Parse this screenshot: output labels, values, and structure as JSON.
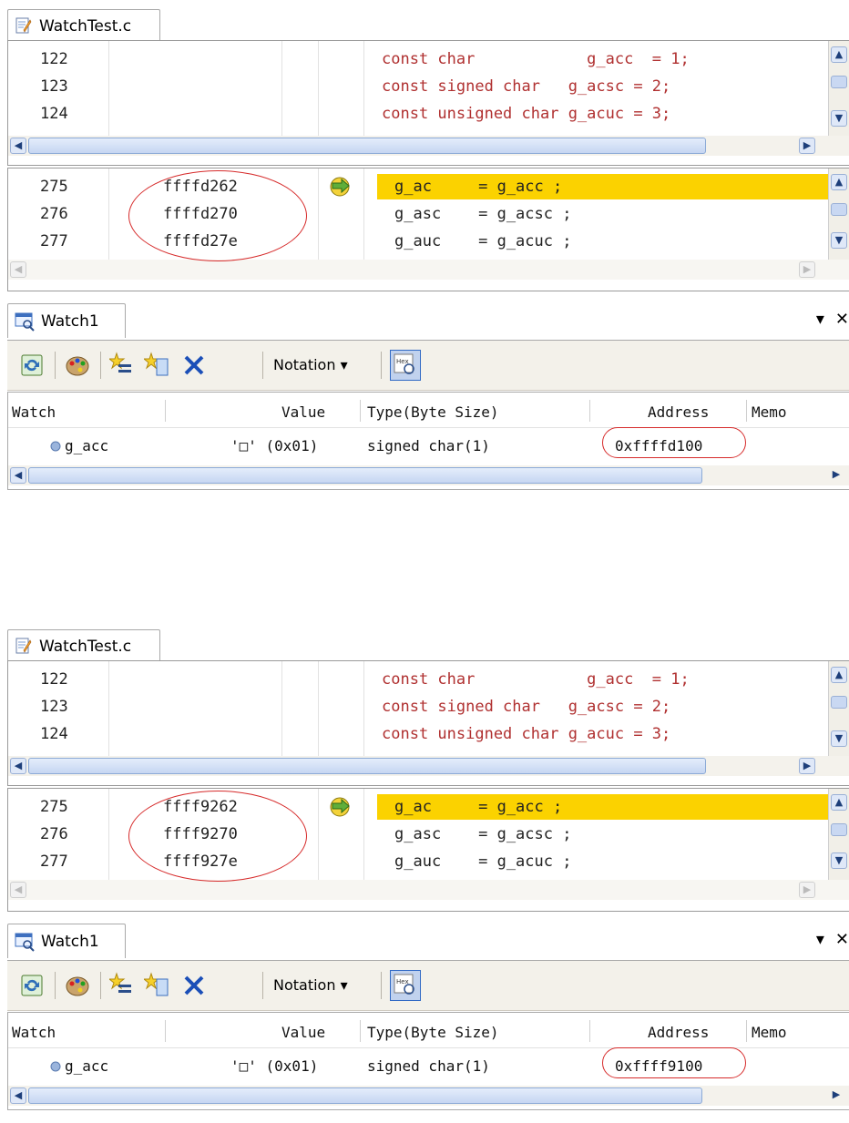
{
  "shots": [
    {
      "file_tab": "WatchTest.c",
      "source_lines": [
        {
          "num": "122",
          "text": "const char            g_acc  = 1;"
        },
        {
          "num": "123",
          "text": "const signed char   g_acsc = 2;"
        },
        {
          "num": "124",
          "text": "const unsigned char g_acuc = 3;"
        }
      ],
      "dis_lines": [
        {
          "num": "275",
          "addr": "ffffd262",
          "code": "g_ac     = g_acc ;"
        },
        {
          "num": "276",
          "addr": "ffffd270",
          "code": "g_asc    = g_acsc ;"
        },
        {
          "num": "277",
          "addr": "ffffd27e",
          "code": "g_auc    = g_acuc ;"
        }
      ],
      "watch_tab": "Watch1",
      "notation": "Notation",
      "columns": {
        "watch": "Watch",
        "value": "Value",
        "type": "Type(Byte Size)",
        "address": "Address",
        "memo": "Memo"
      },
      "row": {
        "name": "g_acc",
        "value": "'□' (0x01)",
        "type": "signed char(1)",
        "address": "0xffffd100"
      }
    },
    {
      "file_tab": "WatchTest.c",
      "source_lines": [
        {
          "num": "122",
          "text": "const char            g_acc  = 1;"
        },
        {
          "num": "123",
          "text": "const signed char   g_acsc = 2;"
        },
        {
          "num": "124",
          "text": "const unsigned char g_acuc = 3;"
        }
      ],
      "dis_lines": [
        {
          "num": "275",
          "addr": "ffff9262",
          "code": "g_ac     = g_acc ;"
        },
        {
          "num": "276",
          "addr": "ffff9270",
          "code": "g_asc    = g_acsc ;"
        },
        {
          "num": "277",
          "addr": "ffff927e",
          "code": "g_auc    = g_acuc ;"
        }
      ],
      "watch_tab": "Watch1",
      "notation": "Notation",
      "columns": {
        "watch": "Watch",
        "value": "Value",
        "type": "Type(Byte Size)",
        "address": "Address",
        "memo": "Memo"
      },
      "row": {
        "name": "g_acc",
        "value": "'□' (0x01)",
        "type": "signed char(1)",
        "address": "0xffff9100"
      }
    }
  ],
  "icons": {
    "file": "source-file-icon",
    "watch": "watch-window-icon",
    "refresh": "refresh-icon",
    "color": "color-palette-icon",
    "add": "add-watch-icon",
    "add_range": "add-range-icon",
    "delete": "delete-icon",
    "hex": "hex-toggle-icon",
    "pointer": "current-pc-arrow-icon"
  },
  "colors": {
    "highlight": "#fbd200",
    "annotation": "#d62b2b",
    "keyword": "#b03030"
  }
}
